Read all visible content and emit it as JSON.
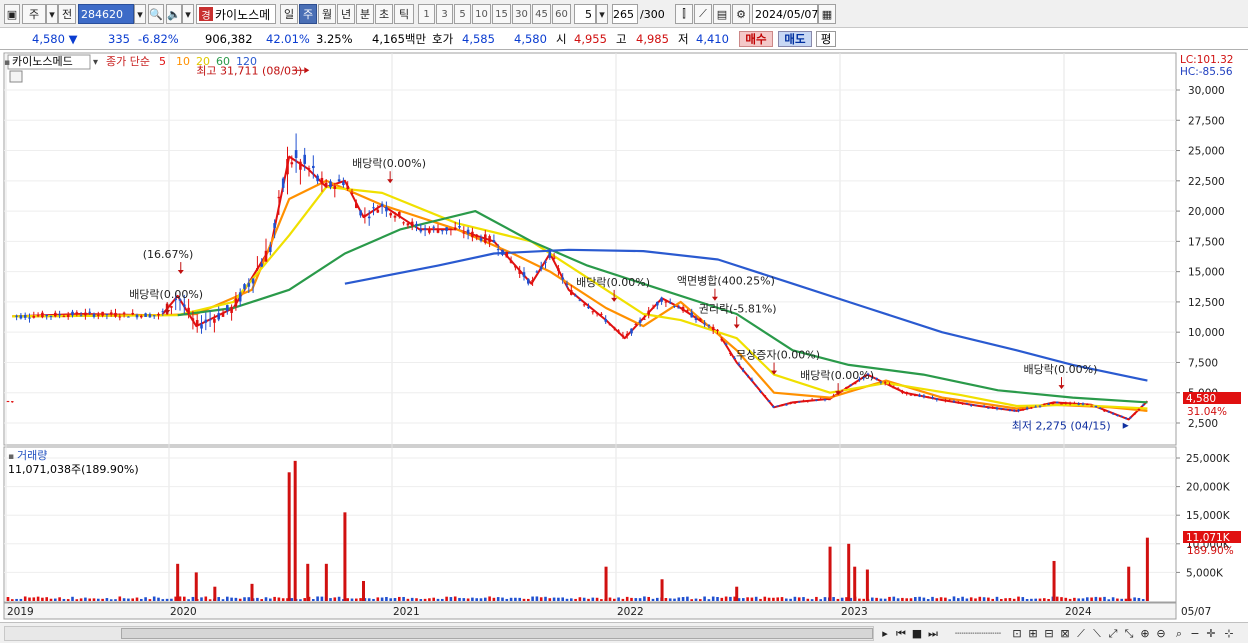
{
  "toolbar": {
    "market_label": "주",
    "prev_label": "전",
    "stock_code": "284620",
    "stock_name": "카이노스메",
    "gyeong_badge": "경",
    "periods": [
      "일",
      "주",
      "월",
      "년",
      "분",
      "초",
      "틱"
    ],
    "active_period": "주",
    "intervals": [
      "1",
      "3",
      "5",
      "10",
      "15",
      "30",
      "45",
      "60"
    ],
    "interval_value": "5",
    "count_value": "265",
    "count_max": "/300",
    "date_value": "2024/05/07"
  },
  "quote": {
    "price": "4,580",
    "change": "335",
    "change_pct": "-6.82%",
    "volume": "906,382",
    "volume_pct": "42.01%",
    "turnover_pct": "3.25%",
    "amount": "4,165백만",
    "bid_label": "호가",
    "ask_price": "4,585",
    "bid_price": "4,580",
    "open_label": "시",
    "open": "4,955",
    "high_label": "고",
    "high": "4,985",
    "low_label": "저",
    "low": "4,410",
    "buy_label": "매수",
    "sell_label": "매도",
    "avg_label": "평"
  },
  "price_panel": {
    "stock_label": "카이노스메드",
    "ma_title": "종가 단순",
    "ma_periods": [
      "5",
      "10",
      "20",
      "60",
      "120"
    ],
    "lc_label": "LC:101.32",
    "hc_label": "HC:-85.56",
    "current_price_tag": "4,580",
    "current_pct_tag": "31.04%"
  },
  "volume_panel": {
    "title": "거래량",
    "value_label": "11,071,038주(189.90%)",
    "current_volume_tag": "11,071K",
    "current_pct_tag": "189.90%"
  },
  "annotations": [
    {
      "text": "최고 31,711 (08/03)",
      "date": "2020-08-03",
      "price": 31711,
      "kind": "high"
    },
    {
      "text": "배당락(0.00%)",
      "date": "2020-12-28",
      "price": 22300,
      "kind": "event"
    },
    {
      "text": "(16.67%)",
      "date": "2020-01-20",
      "price": 14800,
      "kind": "event"
    },
    {
      "text": "배당락(0.00%)",
      "date": "2019-12-27",
      "price": 11500,
      "kind": "event"
    },
    {
      "text": "배당락(0.00%)",
      "date": "2021-12-28",
      "price": 12500,
      "kind": "event"
    },
    {
      "text": "액면병합(400.25%)",
      "date": "2022-06-10",
      "price": 12600,
      "kind": "event"
    },
    {
      "text": "권리락(-5.81%)",
      "date": "2022-07-15",
      "price": 10300,
      "kind": "event"
    },
    {
      "text": "무상증자(0.00%)",
      "date": "2022-09-15",
      "price": 6500,
      "kind": "event"
    },
    {
      "text": "배당락(0.00%)",
      "date": "2022-12-28",
      "price": 4800,
      "kind": "event"
    },
    {
      "text": "배당락(0.00%)",
      "date": "2023-12-27",
      "price": 5300,
      "kind": "event"
    },
    {
      "text": "최저 2,275 (04/15)",
      "date": "2024-04-15",
      "price": 2275,
      "kind": "low"
    }
  ],
  "chart_data": [
    {
      "type": "candlestick-line",
      "title": "카이노스메드",
      "x_ticks": [
        "2019",
        "2020",
        "2021",
        "2022",
        "2023",
        "2024",
        "05/07"
      ],
      "y_ticks": [
        "30,000",
        "27,500",
        "25,000",
        "22,500",
        "20,000",
        "17,500",
        "15,000",
        "12,500",
        "10,000",
        "7,500",
        "5,000",
        "2,500"
      ],
      "ylim": [
        0,
        32000
      ],
      "series": [
        {
          "name": "5",
          "color": "#e01010",
          "points": [
            [
              "2019-01",
              11300
            ],
            [
              "2019-06",
              11500
            ],
            [
              "2019-12",
              11400
            ],
            [
              "2020-01",
              13000
            ],
            [
              "2020-02",
              10500
            ],
            [
              "2020-04",
              12000
            ],
            [
              "2020-06",
              17000
            ],
            [
              "2020-07",
              24500
            ],
            [
              "2020-08",
              23500
            ],
            [
              "2020-09",
              22000
            ],
            [
              "2020-10",
              22500
            ],
            [
              "2020-11",
              19500
            ],
            [
              "2020-12",
              20500
            ],
            [
              "2021-02",
              18500
            ],
            [
              "2021-04",
              18500
            ],
            [
              "2021-06",
              17500
            ],
            [
              "2021-08",
              14000
            ],
            [
              "2021-09",
              16500
            ],
            [
              "2021-10",
              13500
            ],
            [
              "2021-12",
              11000
            ],
            [
              "2022-01",
              9500
            ],
            [
              "2022-03",
              12800
            ],
            [
              "2022-04",
              12000
            ],
            [
              "2022-06",
              10000
            ],
            [
              "2022-07",
              7500
            ],
            [
              "2022-09",
              3800
            ],
            [
              "2022-10",
              4200
            ],
            [
              "2022-12",
              4500
            ],
            [
              "2023-02",
              6500
            ],
            [
              "2023-04",
              5000
            ],
            [
              "2023-06",
              4400
            ],
            [
              "2023-08",
              3900
            ],
            [
              "2023-10",
              3500
            ],
            [
              "2023-12",
              4200
            ],
            [
              "2024-02",
              4000
            ],
            [
              "2024-04",
              2800
            ],
            [
              "2024-05",
              4300
            ]
          ]
        },
        {
          "name": "10",
          "color": "#ff9000",
          "points": [
            [
              "2019-01",
              11300
            ],
            [
              "2019-12",
              11400
            ],
            [
              "2020-02",
              11500
            ],
            [
              "2020-05",
              13500
            ],
            [
              "2020-07",
              21000
            ],
            [
              "2020-09",
              22500
            ],
            [
              "2020-12",
              20500
            ],
            [
              "2021-04",
              18500
            ],
            [
              "2021-07",
              16500
            ],
            [
              "2021-09",
              15000
            ],
            [
              "2021-12",
              12000
            ],
            [
              "2022-02",
              10500
            ],
            [
              "2022-04",
              12500
            ],
            [
              "2022-07",
              8500
            ],
            [
              "2022-09",
              5000
            ],
            [
              "2022-12",
              4600
            ],
            [
              "2023-03",
              6000
            ],
            [
              "2023-06",
              4600
            ],
            [
              "2023-10",
              3700
            ],
            [
              "2023-12",
              4000
            ],
            [
              "2024-03",
              3800
            ],
            [
              "2024-05",
              3500
            ]
          ]
        },
        {
          "name": "20",
          "color": "#f0e000",
          "points": [
            [
              "2019-01",
              11300
            ],
            [
              "2020-01",
              11400
            ],
            [
              "2020-04",
              12500
            ],
            [
              "2020-07",
              18000
            ],
            [
              "2020-09",
              22000
            ],
            [
              "2020-12",
              21500
            ],
            [
              "2021-04",
              19000
            ],
            [
              "2021-08",
              17500
            ],
            [
              "2021-11",
              14500
            ],
            [
              "2022-02",
              11500
            ],
            [
              "2022-04",
              11000
            ],
            [
              "2022-07",
              9500
            ],
            [
              "2022-09",
              6500
            ],
            [
              "2022-12",
              5000
            ],
            [
              "2023-03",
              5800
            ],
            [
              "2023-07",
              4800
            ],
            [
              "2023-10",
              3900
            ],
            [
              "2024-01",
              4000
            ],
            [
              "2024-05",
              3700
            ]
          ]
        },
        {
          "name": "60",
          "color": "#2a9a4a",
          "points": [
            [
              "2020-01",
              11400
            ],
            [
              "2020-04",
              12000
            ],
            [
              "2020-07",
              13500
            ],
            [
              "2020-10",
              16500
            ],
            [
              "2021-01",
              18500
            ],
            [
              "2021-05",
              20000
            ],
            [
              "2021-08",
              17500
            ],
            [
              "2021-11",
              15500
            ],
            [
              "2022-03",
              13500
            ],
            [
              "2022-07",
              11500
            ],
            [
              "2022-10",
              8500
            ],
            [
              "2023-01",
              7300
            ],
            [
              "2023-05",
              6500
            ],
            [
              "2023-09",
              5200
            ],
            [
              "2024-01",
              4600
            ],
            [
              "2024-05",
              4200
            ]
          ]
        },
        {
          "name": "120",
          "color": "#2a5ad0",
          "points": [
            [
              "2020-10",
              14000
            ],
            [
              "2021-03",
              15500
            ],
            [
              "2021-06",
              16500
            ],
            [
              "2021-10",
              16800
            ],
            [
              "2022-02",
              16700
            ],
            [
              "2022-06",
              16000
            ],
            [
              "2022-10",
              14000
            ],
            [
              "2023-02",
              12000
            ],
            [
              "2023-06",
              10000
            ],
            [
              "2023-10",
              8500
            ],
            [
              "2024-01",
              7300
            ],
            [
              "2024-05",
              6000
            ]
          ]
        }
      ]
    },
    {
      "type": "bar",
      "title": "거래량",
      "y_ticks": [
        "25,000K",
        "20,000K",
        "15,000K",
        "10,000K",
        "5,000K"
      ],
      "ylim": [
        0,
        26000
      ],
      "bars_k": [
        [
          "2020-01",
          6500
        ],
        [
          "2020-02",
          5000
        ],
        [
          "2020-03",
          2500
        ],
        [
          "2020-05",
          3000
        ],
        [
          "2020-07",
          22500
        ],
        [
          "2020-07b",
          24500
        ],
        [
          "2020-08",
          6500
        ],
        [
          "2020-09",
          6500
        ],
        [
          "2020-10",
          15500
        ],
        [
          "2020-11",
          3500
        ],
        [
          "2021-12",
          6000
        ],
        [
          "2022-03",
          3800
        ],
        [
          "2022-07",
          2500
        ],
        [
          "2022-12",
          9500
        ],
        [
          "2023-01",
          10000
        ],
        [
          "2023-01b",
          6000
        ],
        [
          "2023-02",
          5500
        ],
        [
          "2023-12",
          7000
        ],
        [
          "2024-04",
          6000
        ],
        [
          "2024-05",
          11071
        ]
      ]
    }
  ]
}
